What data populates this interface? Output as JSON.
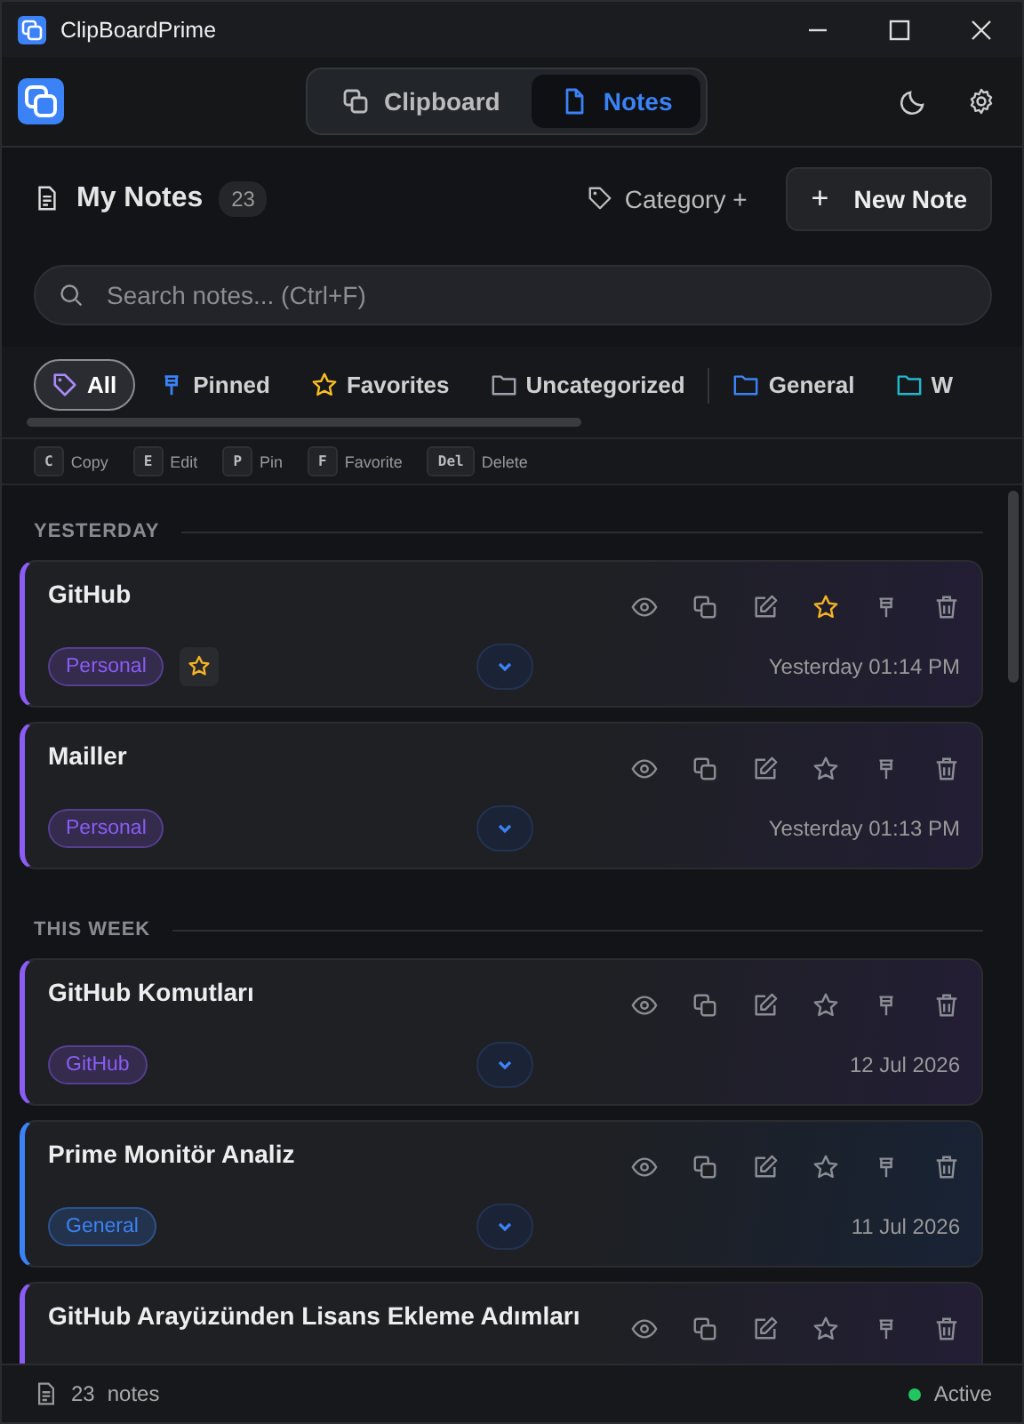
{
  "window": {
    "title": "ClipBoardPrime"
  },
  "nav_tabs": [
    {
      "label": "Clipboard",
      "kind": "clipboard",
      "selected": false
    },
    {
      "label": "Notes",
      "kind": "note",
      "selected": true
    }
  ],
  "header": {
    "title": "My Notes",
    "count": "23",
    "category_button": "Category +",
    "new_button": "New Note",
    "new_icon": "+"
  },
  "search": {
    "placeholder": "Search notes... (Ctrl+F)"
  },
  "filters": [
    {
      "label": "All",
      "kind": "tag",
      "color": "#a78bfa",
      "selected": true
    },
    {
      "label": "Pinned",
      "kind": "pin",
      "color": "#3b82f6",
      "selected": false
    },
    {
      "label": "Favorites",
      "kind": "star",
      "color": "#fbbf24",
      "selected": false
    },
    {
      "label": "Uncategorized",
      "kind": "folder",
      "color": "#9ca3af",
      "selected": false
    },
    {
      "label": "General",
      "kind": "folder",
      "color": "#3b82f6",
      "selected": false
    },
    {
      "label": "W",
      "kind": "folder",
      "color": "#22b8cf",
      "selected": false
    }
  ],
  "shortcuts": [
    {
      "key": "C",
      "label": "Copy"
    },
    {
      "key": "E",
      "label": "Edit"
    },
    {
      "key": "P",
      "label": "Pin"
    },
    {
      "key": "F",
      "label": "Favorite"
    },
    {
      "key": "Del",
      "label": "Delete"
    }
  ],
  "groups": [
    {
      "label": "YESTERDAY",
      "notes": [
        {
          "title": "GitHub",
          "tag": "Personal",
          "color": "#8b5cf6",
          "favorite": true,
          "date": "Yesterday 01:14 PM"
        },
        {
          "title": "Mailler",
          "tag": "Personal",
          "color": "#8b5cf6",
          "favorite": false,
          "date": "Yesterday 01:13 PM"
        }
      ]
    },
    {
      "label": "THIS WEEK",
      "notes": [
        {
          "title": "GitHub Komutları",
          "tag": "GitHub",
          "color": "#8b5cf6",
          "favorite": false,
          "date": "12 Jul 2026"
        },
        {
          "title": "Prime Monitör Analiz",
          "tag": "General",
          "color": "#3b82f6",
          "favorite": false,
          "date": "11 Jul 2026"
        },
        {
          "title": "GitHub Arayüzünden Lisans Ekleme Adımları",
          "color": "#8b5cf6",
          "favorite": false
        }
      ]
    }
  ],
  "status_bar": {
    "count": "23",
    "unit": "notes",
    "status": "Active"
  }
}
